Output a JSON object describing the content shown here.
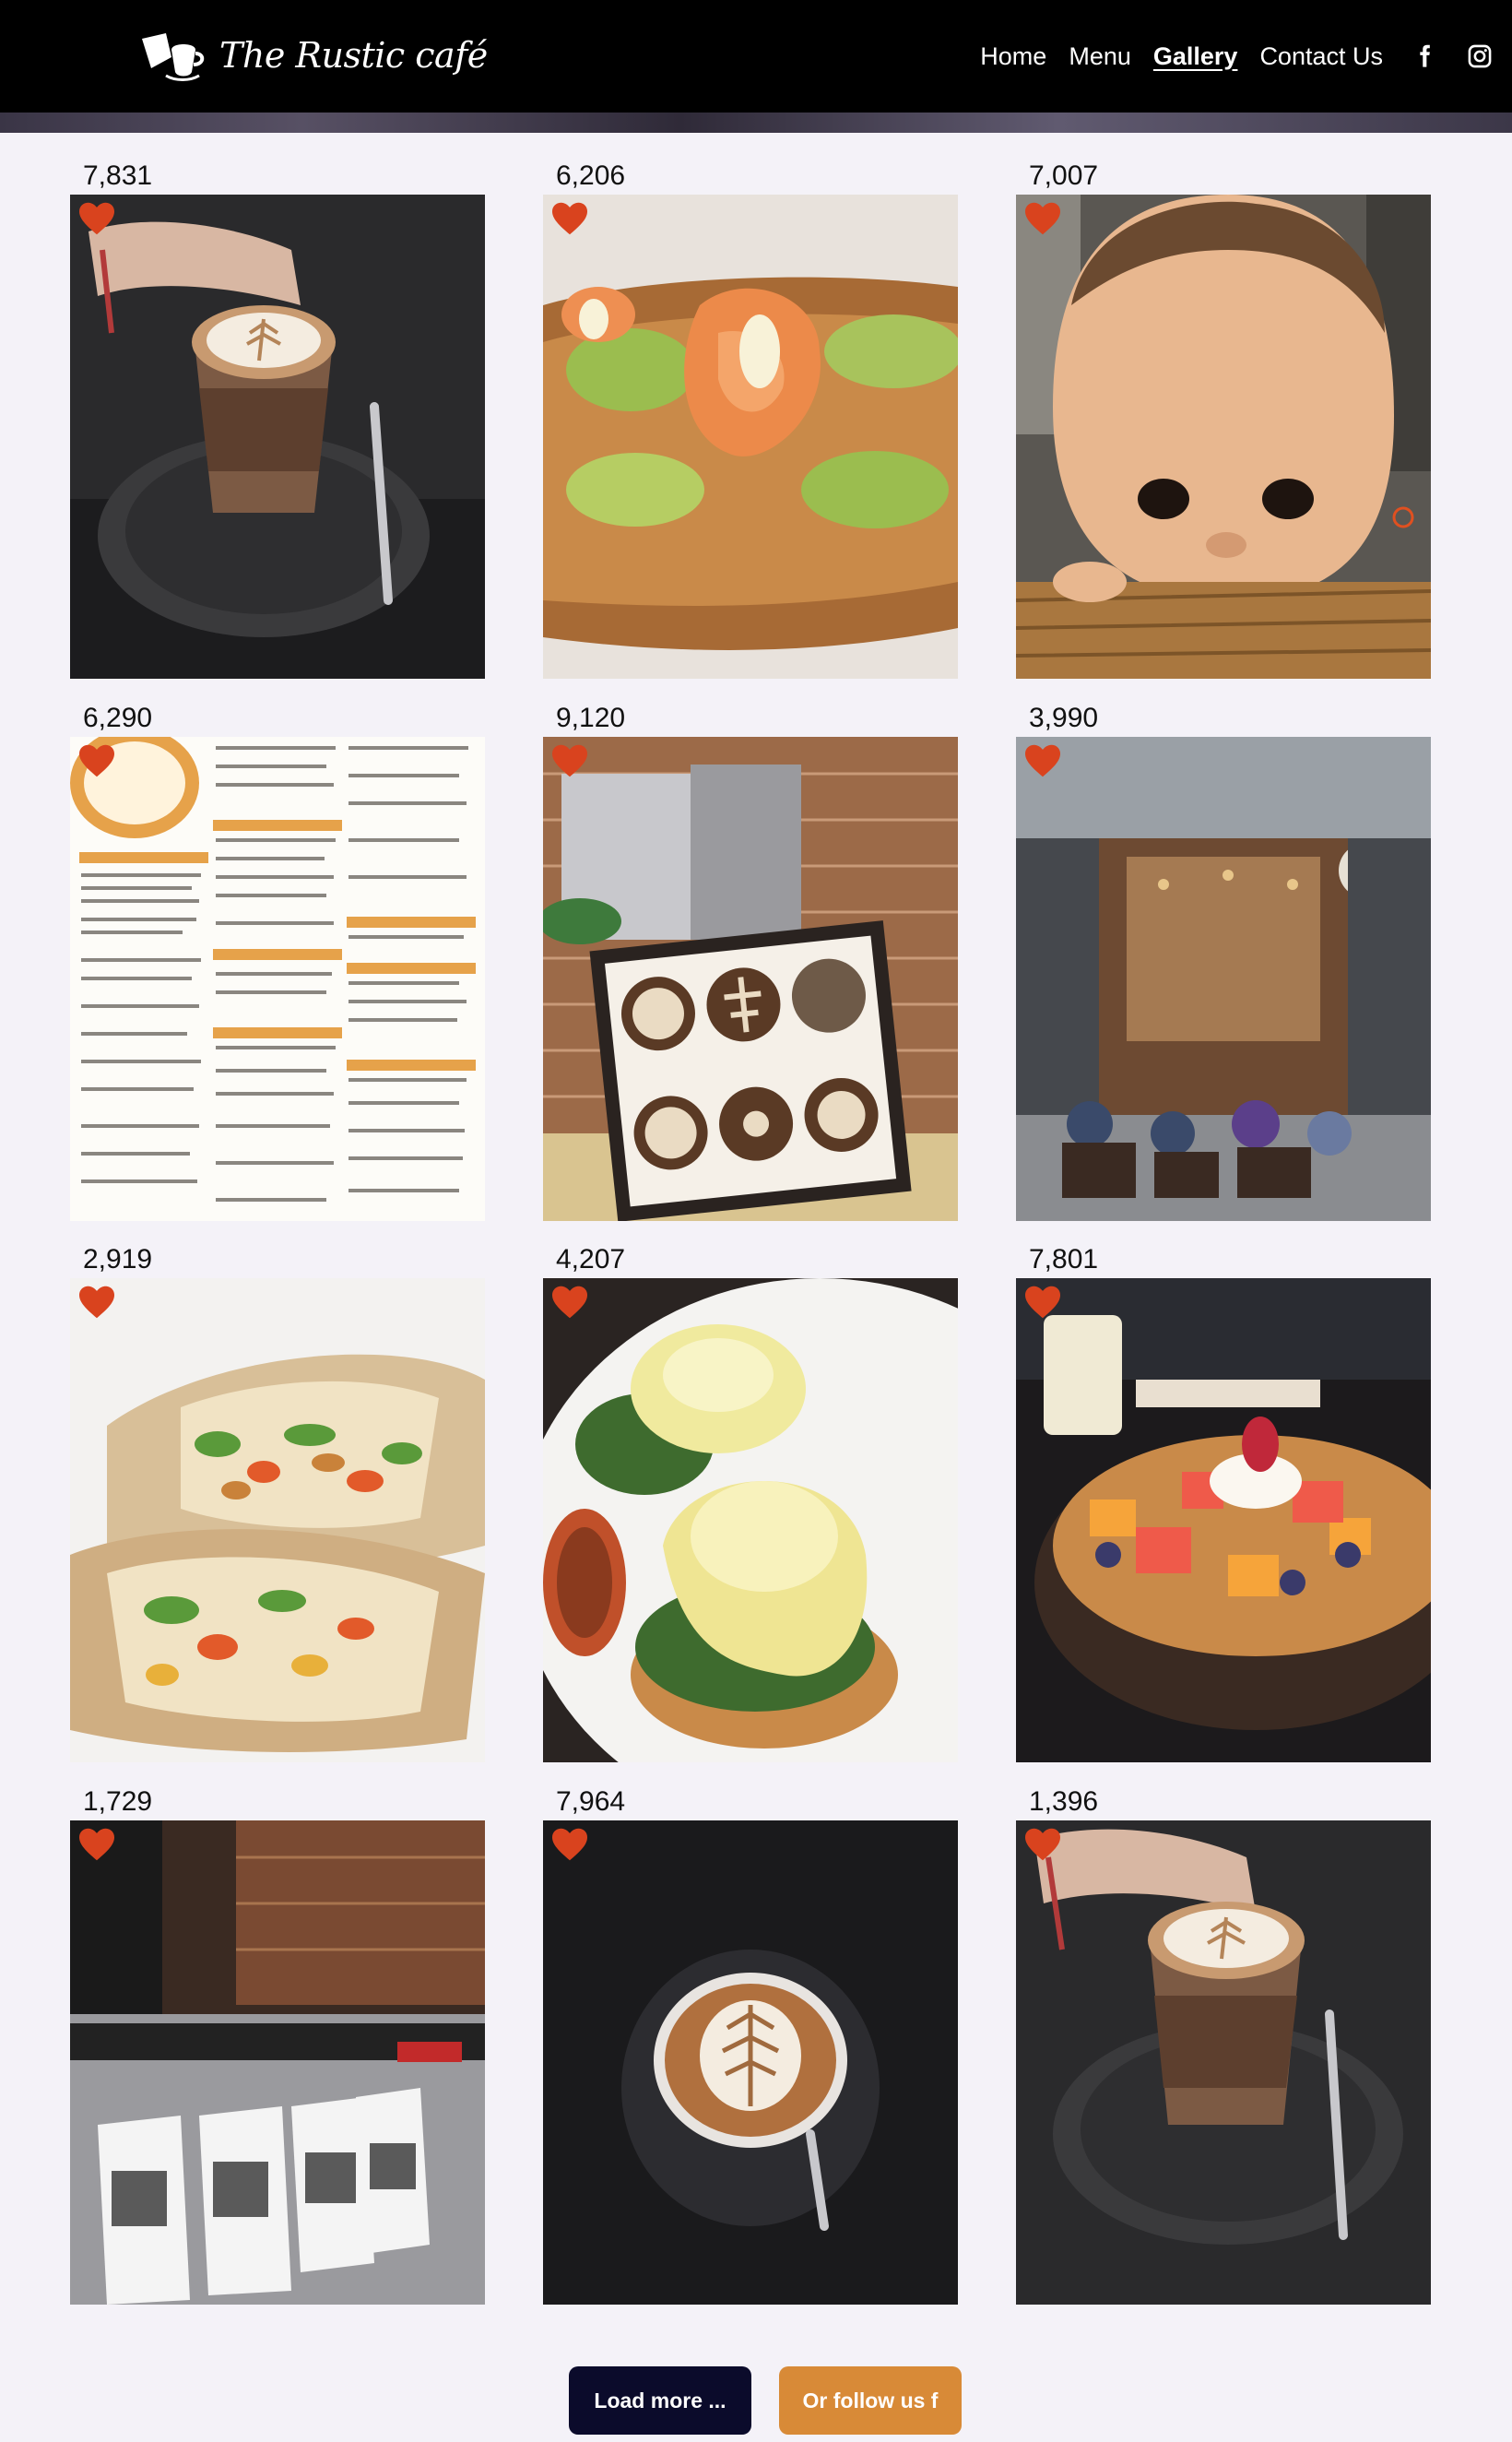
{
  "nav": {
    "logo_text": "The Rustic café",
    "links": [
      {
        "label": "Home",
        "active": false
      },
      {
        "label": "Menu",
        "active": false
      },
      {
        "label": "Gallery",
        "active": true
      },
      {
        "label": "Contact Us",
        "active": false
      }
    ],
    "social_icons": [
      "facebook-icon",
      "instagram-icon"
    ]
  },
  "gallery": {
    "items": [
      {
        "likes": "7,831",
        "subject": "latte art coffee in glass held by hand"
      },
      {
        "likes": "6,206",
        "subject": "smoked salmon avocado toast"
      },
      {
        "likes": "7,007",
        "subject": "baby at wooden table"
      },
      {
        "likes": "6,290",
        "subject": "cafe menu"
      },
      {
        "likes": "9,120",
        "subject": "framed latte art photos"
      },
      {
        "likes": "3,990",
        "subject": "cafe storefront with diners"
      },
      {
        "likes": "2,919",
        "subject": "chicken wrap"
      },
      {
        "likes": "4,207",
        "subject": "eggs benedict"
      },
      {
        "likes": "7,801",
        "subject": "fruit granola bowl"
      },
      {
        "likes": "1,729",
        "subject": "coffee bean bags at counter"
      },
      {
        "likes": "7,964",
        "subject": "latte art cup from above"
      },
      {
        "likes": "1,396",
        "subject": "latte art coffee in glass held by hand"
      }
    ],
    "heart_color": "#d9431e"
  },
  "buttons": {
    "load_more": "Load more ...",
    "follow": "Or follow us f"
  },
  "colors": {
    "nav_bg": "#000000",
    "page_bg": "#f4f2f8",
    "load_btn": "#0b0b2b",
    "follow_btn": "#d88a37"
  }
}
